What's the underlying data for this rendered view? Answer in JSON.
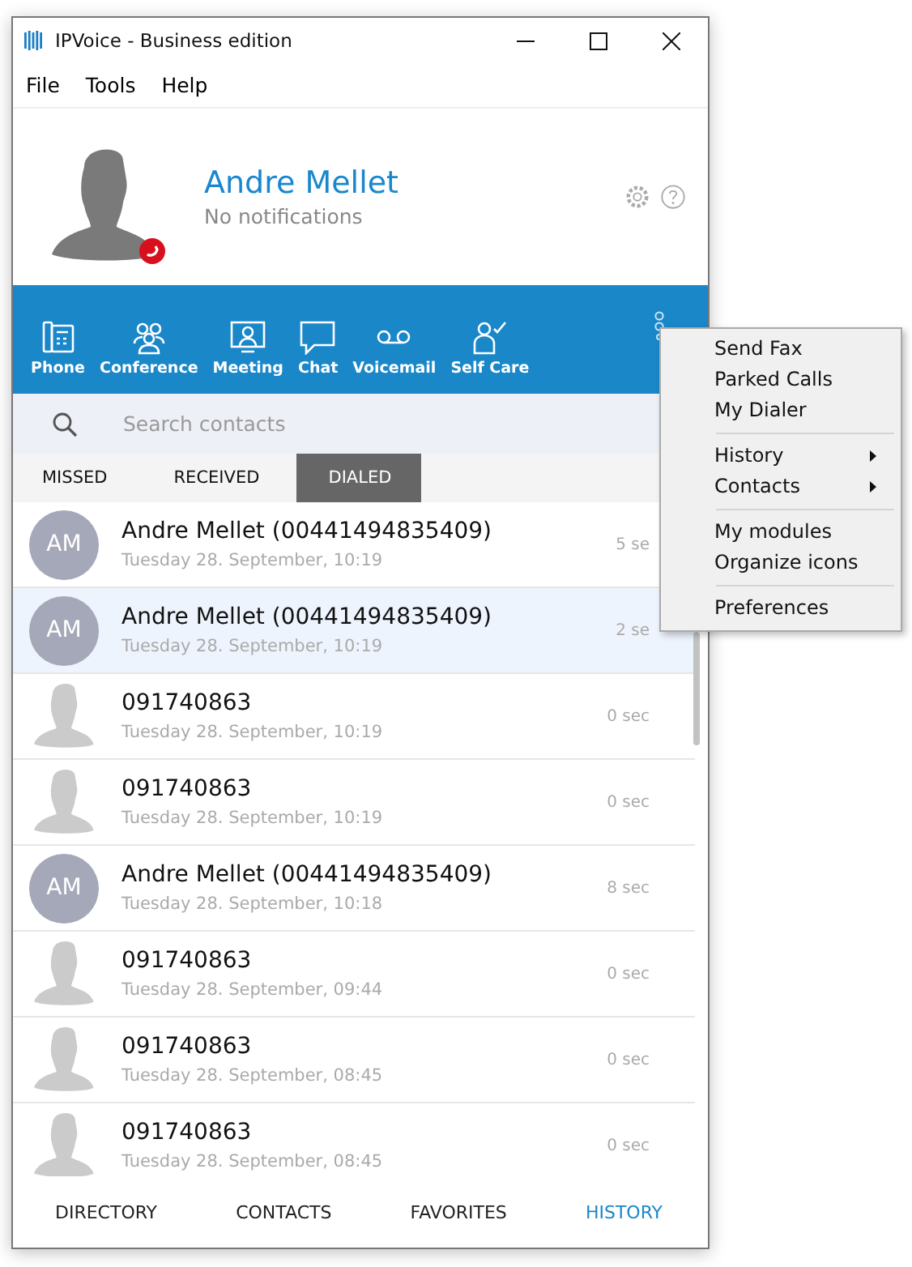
{
  "window": {
    "title": "IPVoice - Business edition"
  },
  "menu_bar": [
    "File",
    "Tools",
    "Help"
  ],
  "profile": {
    "name": "Andre Mellet",
    "status": "No notifications"
  },
  "toolbar": [
    {
      "label": "Phone"
    },
    {
      "label": "Conference"
    },
    {
      "label": "Meeting"
    },
    {
      "label": "Chat"
    },
    {
      "label": "Voicemail"
    },
    {
      "label": "Self Care"
    }
  ],
  "search": {
    "placeholder": "Search contacts"
  },
  "tabs": [
    {
      "label": "MISSED",
      "selected": false
    },
    {
      "label": "RECEIVED",
      "selected": false
    },
    {
      "label": "DIALED",
      "selected": true
    }
  ],
  "calls": [
    {
      "kind": "contact",
      "initials": "AM",
      "name": "Andre Mellet (00441494835409)",
      "time": "Tuesday 28. September, 10:19",
      "duration": "5 se",
      "selected": false
    },
    {
      "kind": "contact",
      "initials": "AM",
      "name": "Andre Mellet (00441494835409)",
      "time": "Tuesday 28. September, 10:19",
      "duration": "2 se",
      "selected": true
    },
    {
      "kind": "number",
      "name": "091740863",
      "time": "Tuesday 28. September, 10:19",
      "duration": "0 sec",
      "selected": false
    },
    {
      "kind": "number",
      "name": "091740863",
      "time": "Tuesday 28. September, 10:19",
      "duration": "0 sec",
      "selected": false
    },
    {
      "kind": "contact",
      "initials": "AM",
      "name": "Andre Mellet (00441494835409)",
      "time": "Tuesday 28. September, 10:18",
      "duration": "8 sec",
      "selected": false
    },
    {
      "kind": "number",
      "name": "091740863",
      "time": "Tuesday 28. September, 09:44",
      "duration": "0 sec",
      "selected": false
    },
    {
      "kind": "number",
      "name": "091740863",
      "time": "Tuesday 28. September, 08:45",
      "duration": "0 sec",
      "selected": false
    },
    {
      "kind": "number",
      "name": "091740863",
      "time": "Tuesday 28. September, 08:45",
      "duration": "0 sec",
      "selected": false
    }
  ],
  "bottom_nav": [
    {
      "label": "DIRECTORY",
      "selected": false
    },
    {
      "label": "CONTACTS",
      "selected": false
    },
    {
      "label": "FAVORITES",
      "selected": false
    },
    {
      "label": "HISTORY",
      "selected": true
    }
  ],
  "context_menu": [
    [
      {
        "label": "Send Fax",
        "submenu": false
      },
      {
        "label": "Parked Calls",
        "submenu": false
      },
      {
        "label": "My Dialer",
        "submenu": false
      }
    ],
    [
      {
        "label": "History",
        "submenu": true
      },
      {
        "label": "Contacts",
        "submenu": true
      }
    ],
    [
      {
        "label": "My modules",
        "submenu": false
      },
      {
        "label": "Organize icons",
        "submenu": false
      }
    ],
    [
      {
        "label": "Preferences",
        "submenu": false
      }
    ]
  ]
}
